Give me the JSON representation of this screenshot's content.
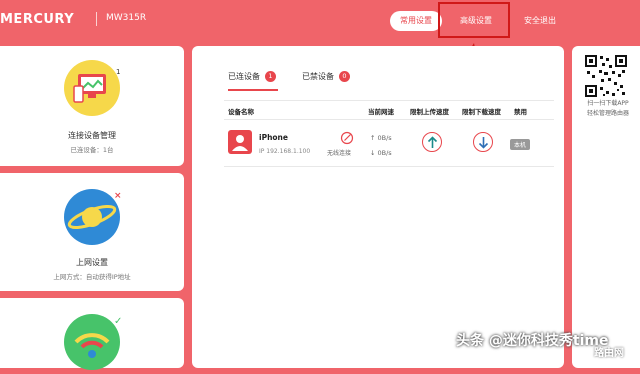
{
  "header": {
    "brand": "MERCURY",
    "model": "MW315R",
    "nav": [
      "常用设置",
      "高级设置",
      "安全退出"
    ]
  },
  "sidebar": {
    "cards": [
      {
        "title": "连接设备管理",
        "subtitle": "已连设备：1台",
        "badge": "1"
      },
      {
        "title": "上网设置",
        "subtitle": "上网方式：自动获得IP地址",
        "badge": "×"
      },
      {
        "title": "",
        "subtitle": "",
        "badge": "✓"
      }
    ]
  },
  "devices": {
    "tabs": [
      {
        "label": "已连设备",
        "count": "1"
      },
      {
        "label": "已禁设备",
        "count": "0"
      }
    ],
    "columns": [
      "设备名称",
      "当前网速",
      "限制上传速度",
      "限制下载速度",
      "禁用"
    ],
    "rows": [
      {
        "name": "iPhone",
        "ip": "IP 192.168.1.100",
        "connection": "无线连接",
        "up_speed": "↑ 0B/s",
        "down_speed": "↓ 0B/s",
        "ban": "本机"
      }
    ]
  },
  "qr": {
    "line1": "扫一扫下载APP",
    "line2": "轻松管理路由器"
  },
  "watermark": {
    "text": "头条 @迷你科技秀time",
    "site": "路由网"
  },
  "colors": {
    "background": "#f0646a",
    "accent": "#e8464c",
    "highlight_box": "#d01818"
  }
}
